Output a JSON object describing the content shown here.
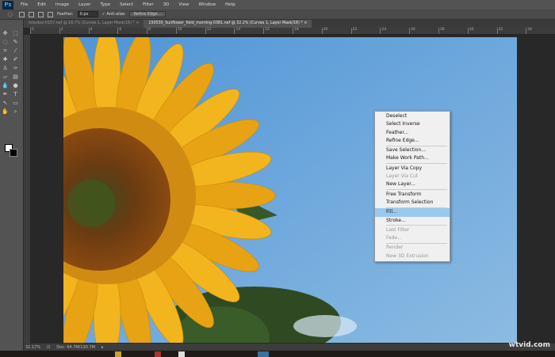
{
  "menubar": {
    "logo": "Ps",
    "items": [
      "File",
      "Edit",
      "Image",
      "Layer",
      "Type",
      "Select",
      "Filter",
      "3D",
      "View",
      "Window",
      "Help"
    ]
  },
  "options": {
    "feather_label": "Feather:",
    "feather_value": "0 px",
    "antialias_label": "Anti-alias",
    "antialias_checked": true,
    "refine_edge": "Refine Edge..."
  },
  "tabs": [
    {
      "label": "Istanbul-0157.nef @ 16.7% (Curves 1, Layer Mask/16) *",
      "active": false
    },
    {
      "label": "150530_Sunflower_field_morning-0381.nef @ 32.2% (Curves 1, Layer Mask/16) *",
      "active": true
    }
  ],
  "ruler": [
    "0",
    "2",
    "4",
    "6",
    "8",
    "10",
    "12",
    "14",
    "16",
    "18",
    "20",
    "22",
    "24",
    "26",
    "28",
    "30",
    "32",
    "34"
  ],
  "context_menu": [
    [
      {
        "label": "Deselect",
        "enabled": true
      },
      {
        "label": "Select Inverse",
        "enabled": true
      },
      {
        "label": "Feather...",
        "enabled": true
      },
      {
        "label": "Refine Edge...",
        "enabled": true
      }
    ],
    [
      {
        "label": "Save Selection...",
        "enabled": true
      },
      {
        "label": "Make Work Path...",
        "enabled": true
      }
    ],
    [
      {
        "label": "Layer Via Copy",
        "enabled": true
      },
      {
        "label": "Layer Via Cut",
        "enabled": false
      },
      {
        "label": "New Layer...",
        "enabled": true
      }
    ],
    [
      {
        "label": "Free Transform",
        "enabled": true
      },
      {
        "label": "Transform Selection",
        "enabled": true
      }
    ],
    [
      {
        "label": "Fill...",
        "enabled": true,
        "highlighted": true
      },
      {
        "label": "Stroke...",
        "enabled": true
      }
    ],
    [
      {
        "label": "Last Filter",
        "enabled": false
      },
      {
        "label": "Fade...",
        "enabled": false
      }
    ],
    [
      {
        "label": "Render",
        "enabled": false
      },
      {
        "label": "New 3D Extrusion",
        "enabled": false
      }
    ]
  ],
  "status": {
    "zoom": "32.17%",
    "doc": "Doc: 64.7M/130.7M"
  },
  "watermark": "wtvid.com"
}
